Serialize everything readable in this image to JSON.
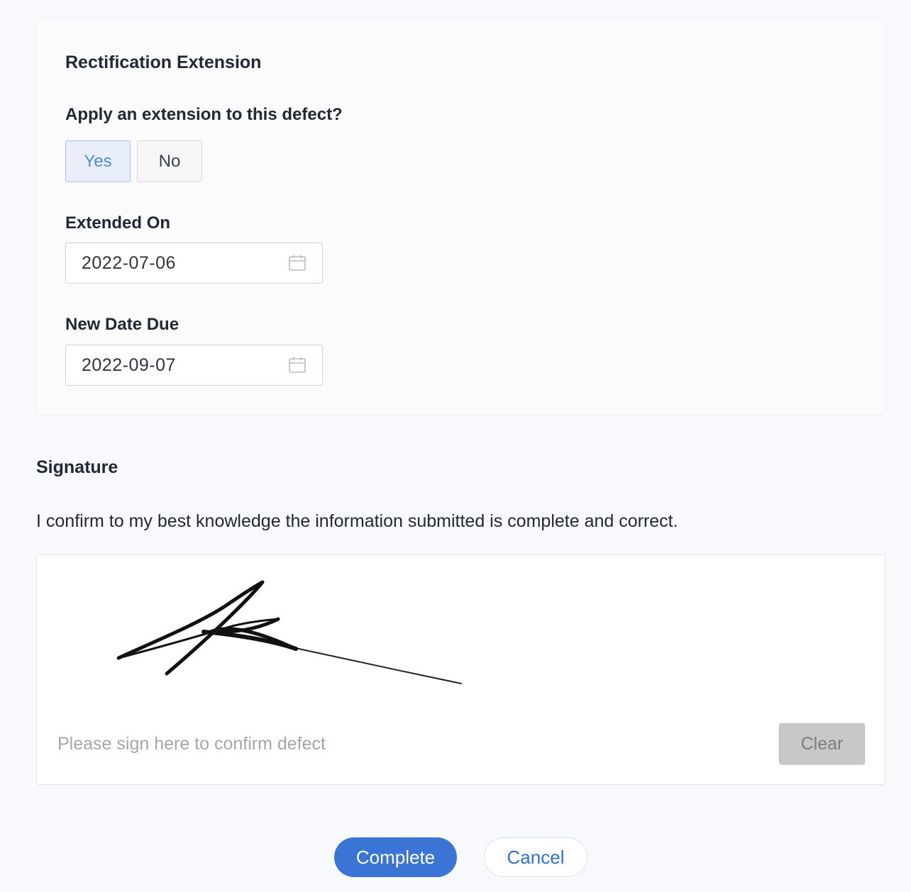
{
  "extension": {
    "section_title": "Rectification Extension",
    "question": "Apply an extension to this defect?",
    "options": [
      {
        "label": "Yes",
        "selected": true
      },
      {
        "label": "No",
        "selected": false
      }
    ],
    "extended_on": {
      "label": "Extended On",
      "value": "2022-07-06",
      "icon": "calendar-icon"
    },
    "new_date_due": {
      "label": "New Date Due",
      "value": "2022-09-07",
      "icon": "calendar-icon"
    }
  },
  "signature": {
    "title": "Signature",
    "statement": "I confirm to my best knowledge the information submitted is complete and correct.",
    "placeholder": "Please sign here to confirm defect",
    "clear_label": "Clear"
  },
  "actions": {
    "complete_label": "Complete",
    "cancel_label": "Cancel"
  },
  "colors": {
    "primary": "#3a75d6",
    "selected_toggle_bg": "#e8effa",
    "selected_toggle_text": "#4e8ae6"
  }
}
